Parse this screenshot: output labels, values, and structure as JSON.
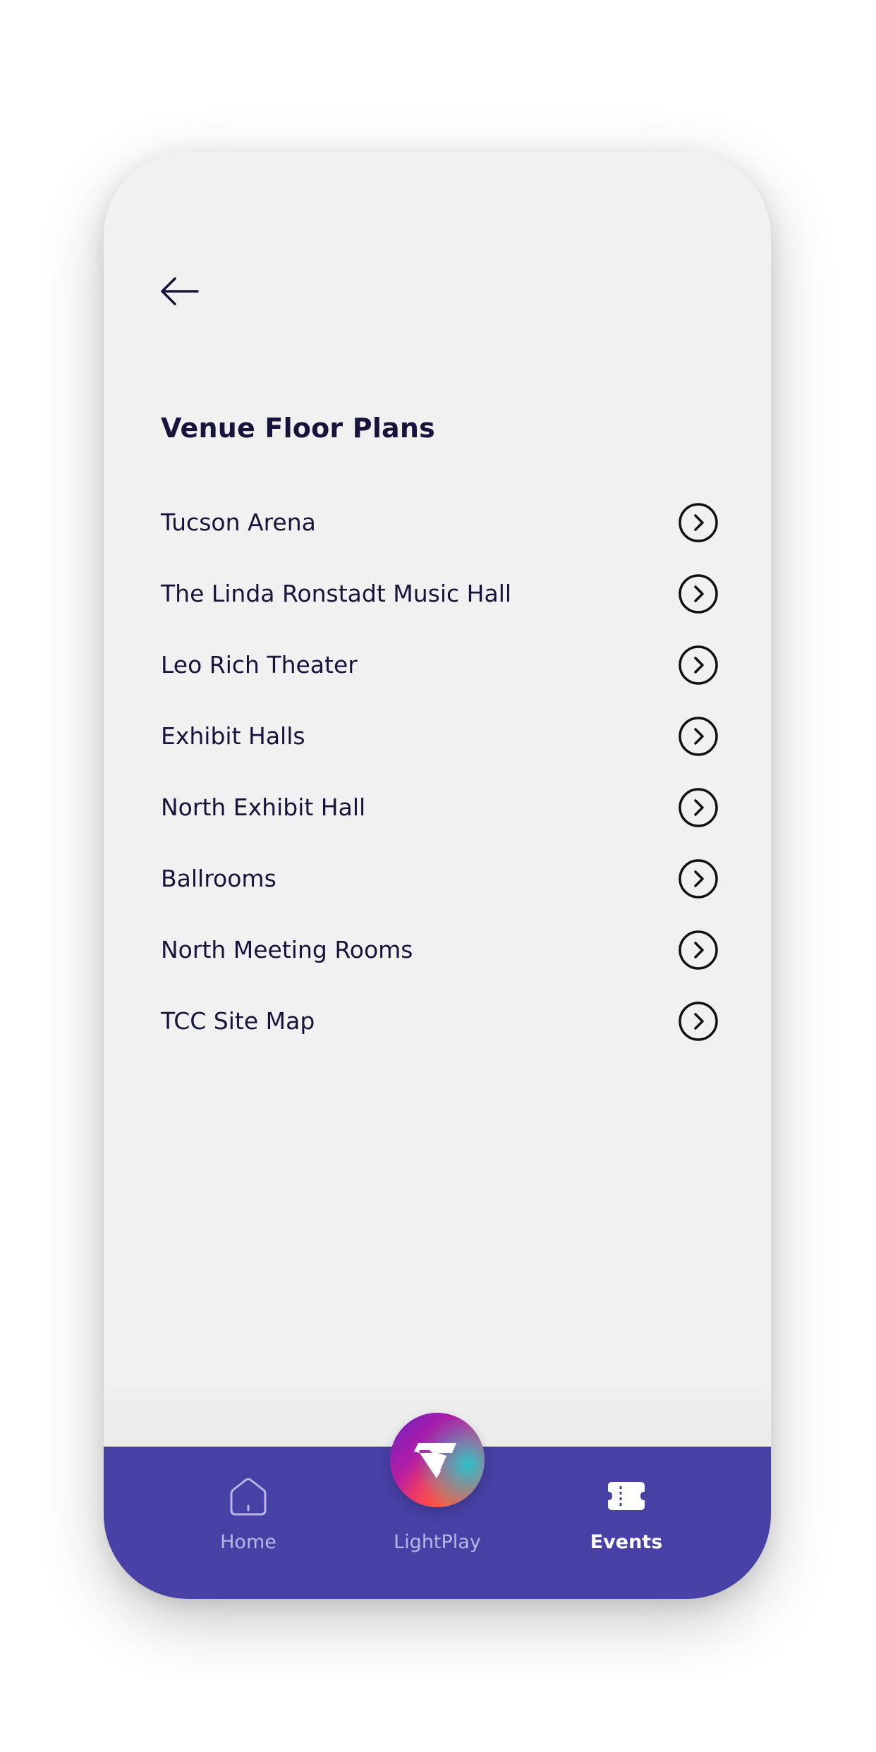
{
  "header": {
    "back_icon": "arrow-left-icon",
    "title": "Venue Floor Plans"
  },
  "venues": [
    {
      "label": "Tucson Arena",
      "icon": "chevron-right-circle-icon"
    },
    {
      "label": "The Linda Ronstadt Music Hall",
      "icon": "chevron-right-circle-icon"
    },
    {
      "label": "Leo Rich Theater",
      "icon": "chevron-right-circle-icon"
    },
    {
      "label": "Exhibit Halls",
      "icon": "chevron-right-circle-icon"
    },
    {
      "label": "North Exhibit Hall",
      "icon": "chevron-right-circle-icon"
    },
    {
      "label": "Ballrooms",
      "icon": "chevron-right-circle-icon"
    },
    {
      "label": "North Meeting Rooms",
      "icon": "chevron-right-circle-icon"
    },
    {
      "label": "TCC Site Map",
      "icon": "chevron-right-circle-icon"
    }
  ],
  "tabbar": {
    "home": {
      "label": "Home",
      "icon": "home-icon"
    },
    "lightplay": {
      "label": "LightPlay",
      "icon": "lightplay-logo-icon"
    },
    "events": {
      "label": "Events",
      "icon": "ticket-icon",
      "active": true
    }
  },
  "colors": {
    "background": "#f1f1f1",
    "text": "#16143a",
    "tabbar": "#4740a5",
    "tab_inactive": "#b9b5e6",
    "tab_active": "#ffffff"
  }
}
